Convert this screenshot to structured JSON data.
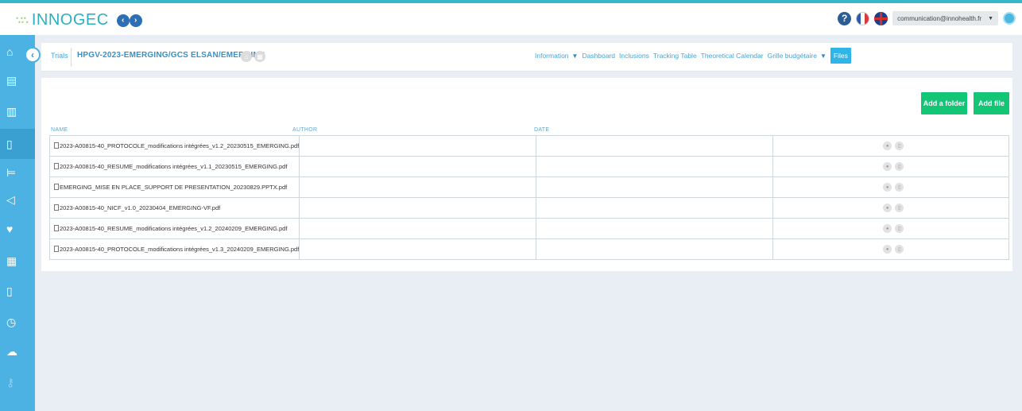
{
  "header": {
    "logo_mark": "∵∴",
    "logo_text": "INNOGEC",
    "arrows": [
      "‹",
      "›"
    ],
    "help": "?",
    "user_email": "communication@innohealth.fr",
    "icons": [
      "help-icon",
      "flag-fr-icon",
      "flag-uk-icon",
      "user-icon"
    ]
  },
  "sidebar": {
    "collapse_glyph": "‹",
    "items": [
      {
        "name": "home-icon",
        "glyph": "⌂"
      },
      {
        "name": "calculator-icon",
        "glyph": "▤"
      },
      {
        "name": "buildings-icon",
        "glyph": "▥"
      },
      {
        "name": "document-icon",
        "glyph": "▯"
      },
      {
        "name": "bed-icon",
        "glyph": "⊨"
      },
      {
        "name": "megaphone-icon",
        "glyph": "◁"
      },
      {
        "name": "heart-icon",
        "glyph": "♥"
      },
      {
        "name": "grid-icon",
        "glyph": "▦"
      },
      {
        "name": "document-export-icon",
        "glyph": "▯"
      },
      {
        "name": "clock-icon",
        "glyph": "◷"
      },
      {
        "name": "cloud-upload-icon",
        "glyph": "☁"
      },
      {
        "name": "key-icon",
        "glyph": "⚷"
      }
    ]
  },
  "breadcrumb": {
    "trials": "Trials",
    "title": "HPGV-2023-EMERGING/GCS ELSAN/EMERGING"
  },
  "nav": {
    "information": "Information",
    "dashboard": "Dashboard",
    "inclusions": "Inclusions",
    "tracking_table": "Tracking Table",
    "theoretical_calendar": "Theoretical Calendar",
    "grille": "Grille budgétaire",
    "files": "Files"
  },
  "actions": {
    "add_folder": "Add a folder",
    "add_file": "Add file"
  },
  "table": {
    "headers": {
      "name": "NAME",
      "author": "AUTHOR",
      "date": "DATE"
    },
    "rows": [
      {
        "name": "2023-A00815-40_PROTOCOLE_modifications intégrées_v1.2_20230515_EMERGING.pdf",
        "author": "",
        "date": ""
      },
      {
        "name": "2023-A00815-40_RESUME_modifications intégrées_v1.1_20230515_EMERGING.pdf",
        "author": "",
        "date": ""
      },
      {
        "name": "EMERGING_MISE EN PLACE_SUPPORT DE PRESENTATION_20230829.PPTX.pdf",
        "author": "",
        "date": ""
      },
      {
        "name": "2023-A00815-40_NICF_v1.0_20230404_EMERGING-VF.pdf",
        "author": "",
        "date": ""
      },
      {
        "name": "2023-A00815-40_RESUME_modifications intégrées_v1.2_20240209_EMERGING.pdf",
        "author": "",
        "date": ""
      },
      {
        "name": "2023-A00815-40_PROTOCOLE_modifications intégrées_v1.3_20240209_EMERGING.pdf",
        "author": "",
        "date": ""
      }
    ]
  },
  "colors": {
    "accent": "#4bb2e3",
    "button_green": "#12c675",
    "title_blue": "#3d8fc5"
  }
}
